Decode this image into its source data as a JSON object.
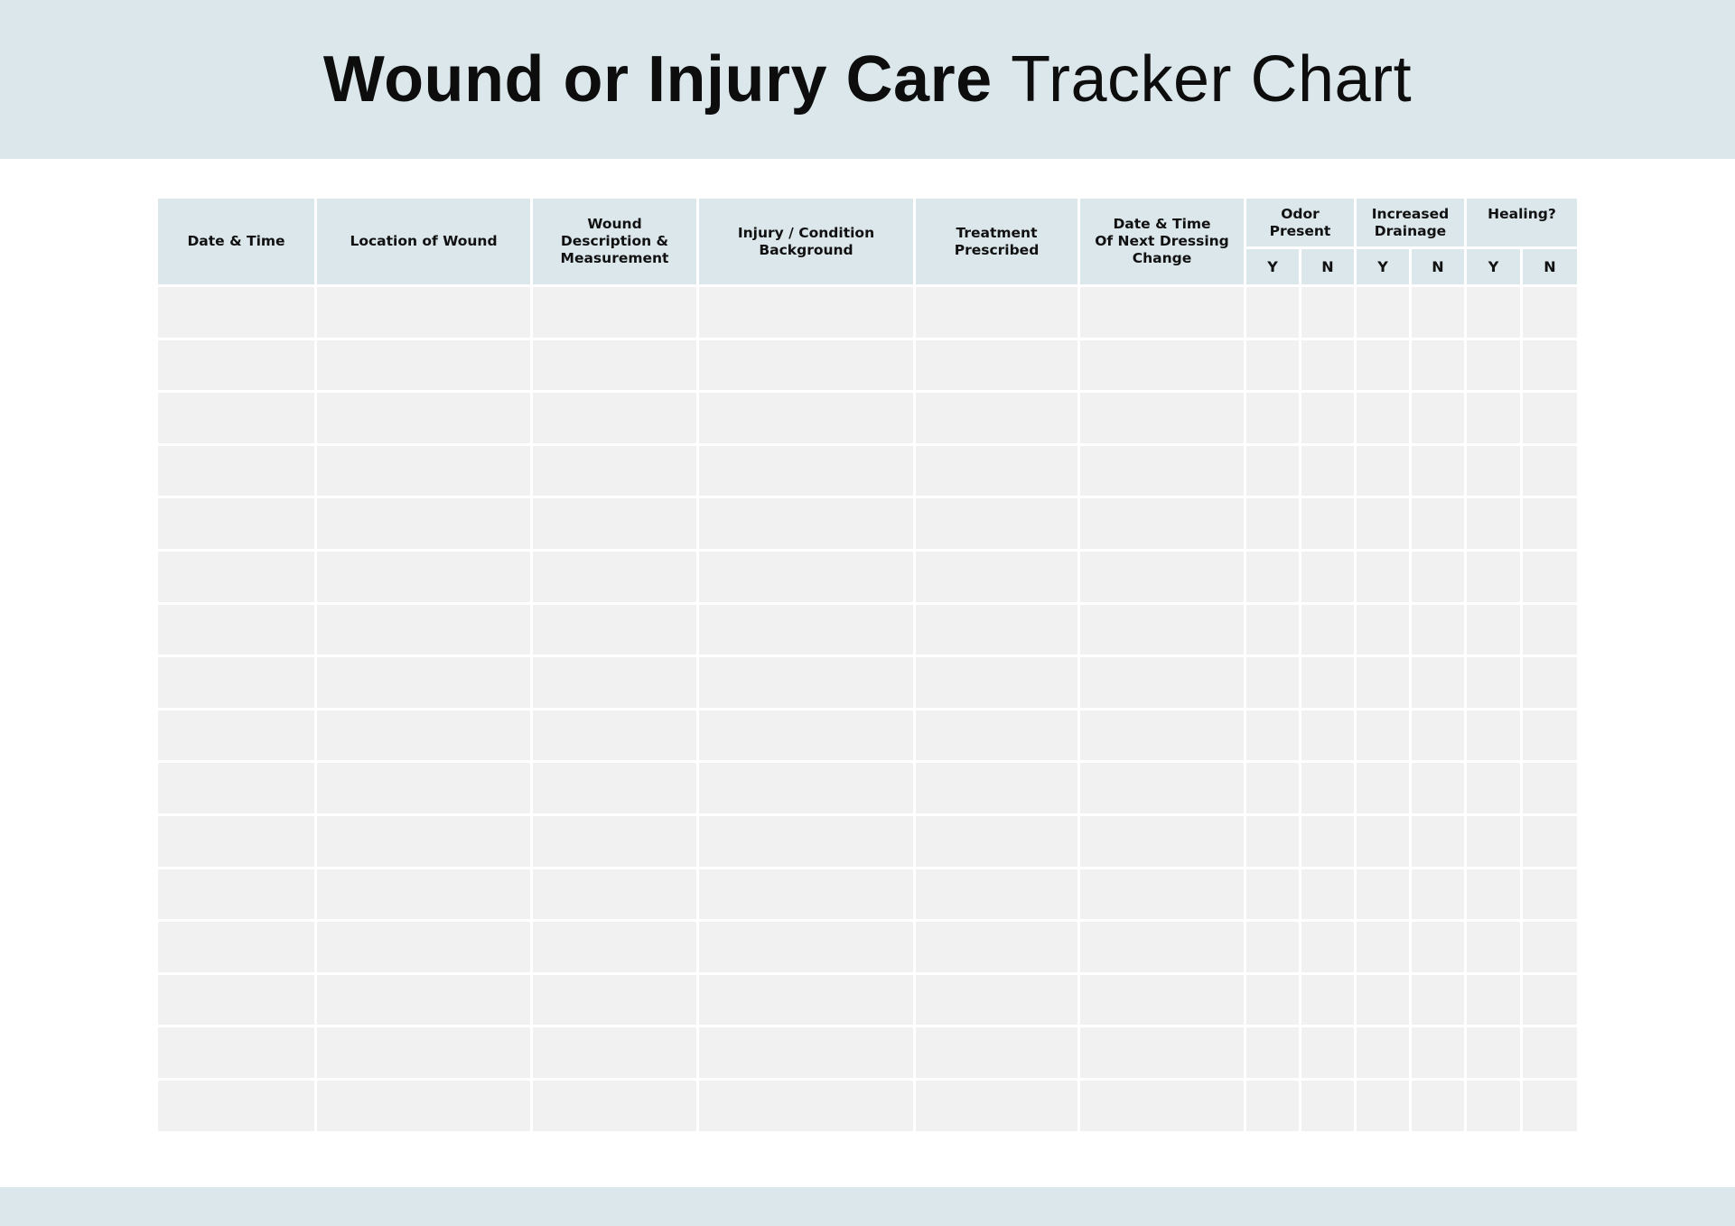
{
  "header": {
    "title_bold": "Wound or Injury Care",
    "title_light": "Tracker Chart"
  },
  "colors": {
    "band": "#dce7eb",
    "header_cell": "#dce7eb",
    "body_cell": "#f1f1f1",
    "text": "#111111"
  },
  "table": {
    "columns": [
      {
        "label": "Date & Time"
      },
      {
        "label": "Location of Wound"
      },
      {
        "label": "Wound\nDescription &\nMeasurement"
      },
      {
        "label": "Injury / Condition\nBackground"
      },
      {
        "label": "Treatment\nPrescribed"
      },
      {
        "label": "Date & Time\nOf Next Dressing\nChange"
      }
    ],
    "groups": [
      {
        "label": "Odor\nPresent",
        "sub": [
          "Y",
          "N"
        ]
      },
      {
        "label": "Increased\nDrainage",
        "sub": [
          "Y",
          "N"
        ]
      },
      {
        "label": "Healing?",
        "sub": [
          "Y",
          "N"
        ]
      }
    ],
    "row_count": 16,
    "rows": [
      [
        "",
        "",
        "",
        "",
        "",
        "",
        "",
        "",
        "",
        "",
        "",
        ""
      ],
      [
        "",
        "",
        "",
        "",
        "",
        "",
        "",
        "",
        "",
        "",
        "",
        ""
      ],
      [
        "",
        "",
        "",
        "",
        "",
        "",
        "",
        "",
        "",
        "",
        "",
        ""
      ],
      [
        "",
        "",
        "",
        "",
        "",
        "",
        "",
        "",
        "",
        "",
        "",
        ""
      ],
      [
        "",
        "",
        "",
        "",
        "",
        "",
        "",
        "",
        "",
        "",
        "",
        ""
      ],
      [
        "",
        "",
        "",
        "",
        "",
        "",
        "",
        "",
        "",
        "",
        "",
        ""
      ],
      [
        "",
        "",
        "",
        "",
        "",
        "",
        "",
        "",
        "",
        "",
        "",
        ""
      ],
      [
        "",
        "",
        "",
        "",
        "",
        "",
        "",
        "",
        "",
        "",
        "",
        ""
      ],
      [
        "",
        "",
        "",
        "",
        "",
        "",
        "",
        "",
        "",
        "",
        "",
        ""
      ],
      [
        "",
        "",
        "",
        "",
        "",
        "",
        "",
        "",
        "",
        "",
        "",
        ""
      ],
      [
        "",
        "",
        "",
        "",
        "",
        "",
        "",
        "",
        "",
        "",
        "",
        ""
      ],
      [
        "",
        "",
        "",
        "",
        "",
        "",
        "",
        "",
        "",
        "",
        "",
        ""
      ],
      [
        "",
        "",
        "",
        "",
        "",
        "",
        "",
        "",
        "",
        "",
        "",
        ""
      ],
      [
        "",
        "",
        "",
        "",
        "",
        "",
        "",
        "",
        "",
        "",
        "",
        ""
      ],
      [
        "",
        "",
        "",
        "",
        "",
        "",
        "",
        "",
        "",
        "",
        "",
        ""
      ],
      [
        "",
        "",
        "",
        "",
        "",
        "",
        "",
        "",
        "",
        "",
        "",
        ""
      ]
    ]
  }
}
